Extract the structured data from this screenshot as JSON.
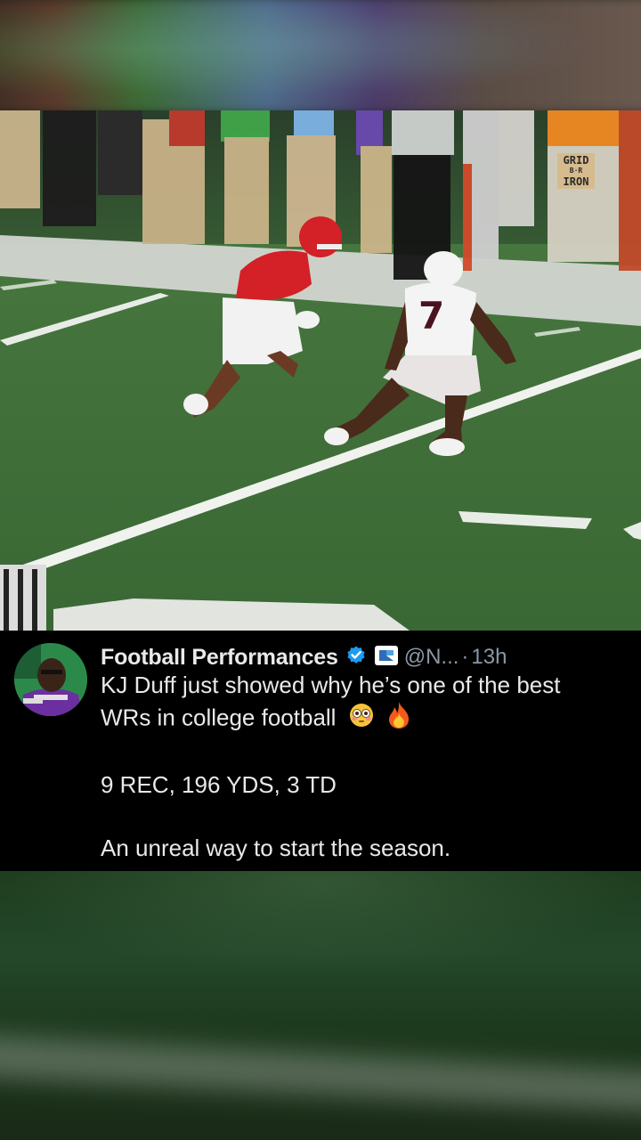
{
  "tweet": {
    "display_name": "Football Performances",
    "handle": "@N...",
    "separator": "·",
    "time": "13h",
    "lines": {
      "line1": "KJ Duff just showed why he’s one of the best",
      "line2": "WRs in college football",
      "stats": "9 REC, 196 YDS, 3 TD",
      "closing": "An unreal way to start the season."
    },
    "emojis": [
      "flushed-face-icon",
      "fire-icon"
    ]
  },
  "video": {
    "watermark": {
      "top": "GRID",
      "middle": "B·R",
      "bottom": "IRON"
    },
    "defender_number": "7"
  },
  "colors": {
    "background": "#000000",
    "text_primary": "#e7e9ea",
    "text_secondary": "#8b98a5",
    "verified_blue": "#1d9bf0",
    "field_green": "#3f6e3a"
  }
}
